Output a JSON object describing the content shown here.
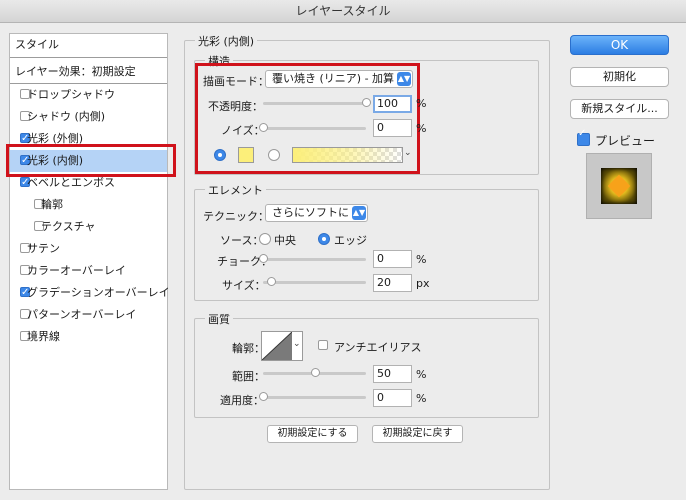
{
  "window": {
    "title": "レイヤースタイル"
  },
  "sidebar": {
    "header": "スタイル",
    "defaults": "レイヤー効果：初期設定",
    "items": [
      {
        "label": "ドロップシャドウ",
        "checked": false
      },
      {
        "label": "シャドウ (内側)",
        "checked": false
      },
      {
        "label": "光彩 (外側)",
        "checked": true
      },
      {
        "label": "光彩 (内側)",
        "checked": true,
        "selected": true
      },
      {
        "label": "ベベルとエンボス",
        "checked": true
      },
      {
        "label": "輪郭",
        "checked": false
      },
      {
        "label": "テクスチャ",
        "checked": false
      },
      {
        "label": "サテン",
        "checked": false
      },
      {
        "label": "カラーオーバーレイ",
        "checked": false
      },
      {
        "label": "グラデーションオーバーレイ",
        "checked": true
      },
      {
        "label": "パターンオーバーレイ",
        "checked": false
      },
      {
        "label": "境界線",
        "checked": false
      }
    ]
  },
  "main": {
    "section_title": "光彩 (内側)",
    "structure": {
      "title": "構造",
      "blend_mode_label": "描画モード：",
      "blend_mode_value": "覆い焼き (リニア) - 加算",
      "opacity_label": "不透明度：",
      "opacity_value": "100",
      "opacity_level": 1.0,
      "noise_label": "ノイズ：",
      "noise_value": "0",
      "noise_level": 0.0,
      "percent": "%",
      "glow_color": "#fcef7a"
    },
    "elements": {
      "title": "エレメント",
      "technique_label": "テクニック：",
      "technique_value": "さらにソフトに",
      "source_label": "ソース：",
      "source_center": "中央",
      "source_edge": "エッジ",
      "choke_label": "チョーク：",
      "choke_value": "0",
      "choke_level": 0.0,
      "size_label": "サイズ：",
      "size_value": "20",
      "size_level": 0.08,
      "px": "px"
    },
    "quality": {
      "title": "画質",
      "contour_label": "輪郭：",
      "antialias_label": "アンチエイリアス",
      "range_label": "範囲：",
      "range_value": "50",
      "range_level": 0.5,
      "jitter_label": "適用度：",
      "jitter_value": "0",
      "jitter_level": 0.0
    },
    "make_default": "初期設定にする",
    "reset_default": "初期設定に戻す"
  },
  "buttons": {
    "ok": "OK",
    "reset": "初期化",
    "new_style": "新規スタイル...",
    "preview_label": "プレビュー"
  },
  "colors": {
    "accent": "#3d88e8",
    "highlight": "#d0121b",
    "selection": "#b5d3f6"
  }
}
